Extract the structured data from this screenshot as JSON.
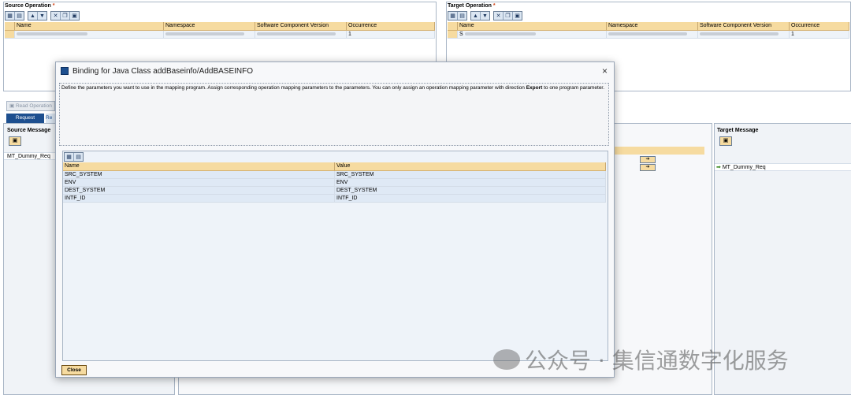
{
  "source_operation": {
    "title": "Source Operation",
    "required_mark": "*",
    "columns": [
      "Name",
      "Namespace",
      "Software Component Version",
      "Occurrence"
    ],
    "row": {
      "occurrence": "1"
    }
  },
  "target_operation": {
    "title": "Target Operation",
    "required_mark": "*",
    "columns": [
      "Name",
      "Namespace",
      "Software Component Version",
      "Occurrence"
    ],
    "row": {
      "name_prefix": "S",
      "occurrence": "1"
    }
  },
  "background": {
    "read_operation_label": "Read Operation",
    "tab_request": "Request",
    "tab_response_partial": "Re",
    "source_message_title": "Source Message",
    "source_message_item": "MT_Dummy_Req",
    "target_message_title": "Target Message",
    "target_message_item": "MT_Dummy_Req"
  },
  "dialog": {
    "title": "Binding for Java Class addBaseinfo/AddBASEINFO",
    "close_glyph": "×",
    "description_part1": "Define the parameters you want to use in the mapping program. Assign corresponding operation mapping parameters to the parameters. You can only assign an operation mapping parameter with direction ",
    "description_bold": "Export",
    "description_part2": " to one program parameter.",
    "table_headers": {
      "name": "Name",
      "value": "Value"
    },
    "rows": [
      {
        "name": "SRC_SYSTEM",
        "value": "SRC_SYSTEM"
      },
      {
        "name": "ENV",
        "value": "ENV"
      },
      {
        "name": "DEST_SYSTEM",
        "value": "DEST_SYSTEM"
      },
      {
        "name": "INTF_ID",
        "value": "INTF_ID"
      }
    ],
    "close_button": "Close"
  },
  "watermark": "公众号 · 集信通数字化服务"
}
